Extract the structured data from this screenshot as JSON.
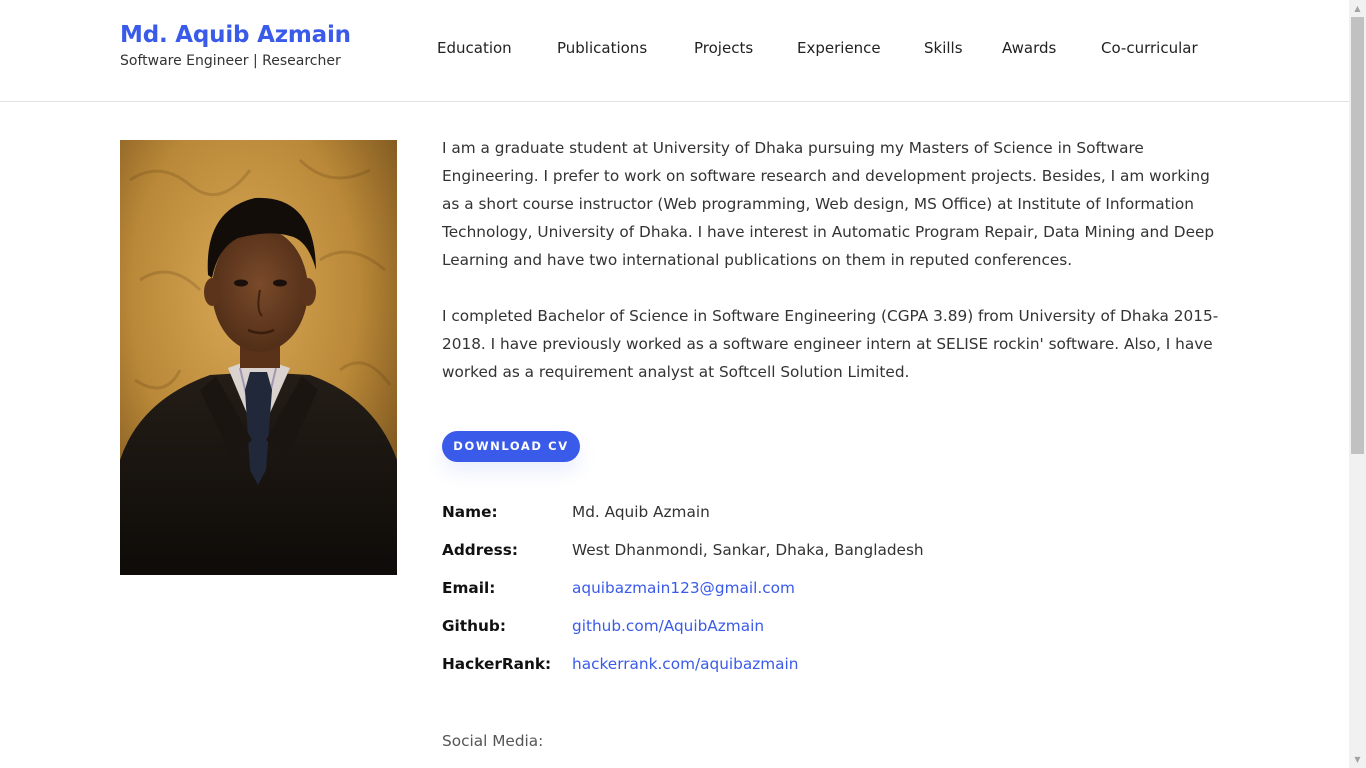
{
  "header": {
    "name": "Md. Aquib Azmain",
    "tagline": "Software Engineer | Researcher",
    "nav": [
      {
        "label": "Education"
      },
      {
        "label": "Publications"
      },
      {
        "label": "Projects"
      },
      {
        "label": "Experience"
      },
      {
        "label": "Skills"
      },
      {
        "label": "Awards"
      },
      {
        "label": "Co-curricular"
      }
    ]
  },
  "about": {
    "paragraphs": [
      "I am a graduate student at University of Dhaka pursuing my Masters of Science in Software Engineering. I prefer to work on software research and development projects. Besides, I am working as a short course instructor (Web programming, Web design, MS Office) at Institute of Information Technology, University of Dhaka. I have interest in Automatic Program Repair, Data Mining and Deep Learning and have two international publications on them in reputed conferences.",
      "I completed Bachelor of Science in Software Engineering (CGPA 3.89) from University of Dhaka 2015-2018. I have previously worked as a software engineer intern at SELISE rockin' software. Also, I have worked as a requirement analyst at Softcell Solution Limited."
    ],
    "cv_button": "DOWNLOAD CV"
  },
  "info": [
    {
      "label": "Name:",
      "value": "Md. Aquib Azmain"
    },
    {
      "label": "Address:",
      "value": "West Dhanmondi, Sankar, Dhaka, Bangladesh"
    },
    {
      "label": "Email:",
      "value": "aquibazmain123@gmail.com"
    },
    {
      "label": "Github:",
      "value": "github.com/AquibAzmain"
    },
    {
      "label": "HackerRank:",
      "value": "hackerrank.com/aquibazmain"
    }
  ],
  "social_label": "Social Media:",
  "colors": {
    "accent": "#3a5bea",
    "text": "#333333"
  }
}
